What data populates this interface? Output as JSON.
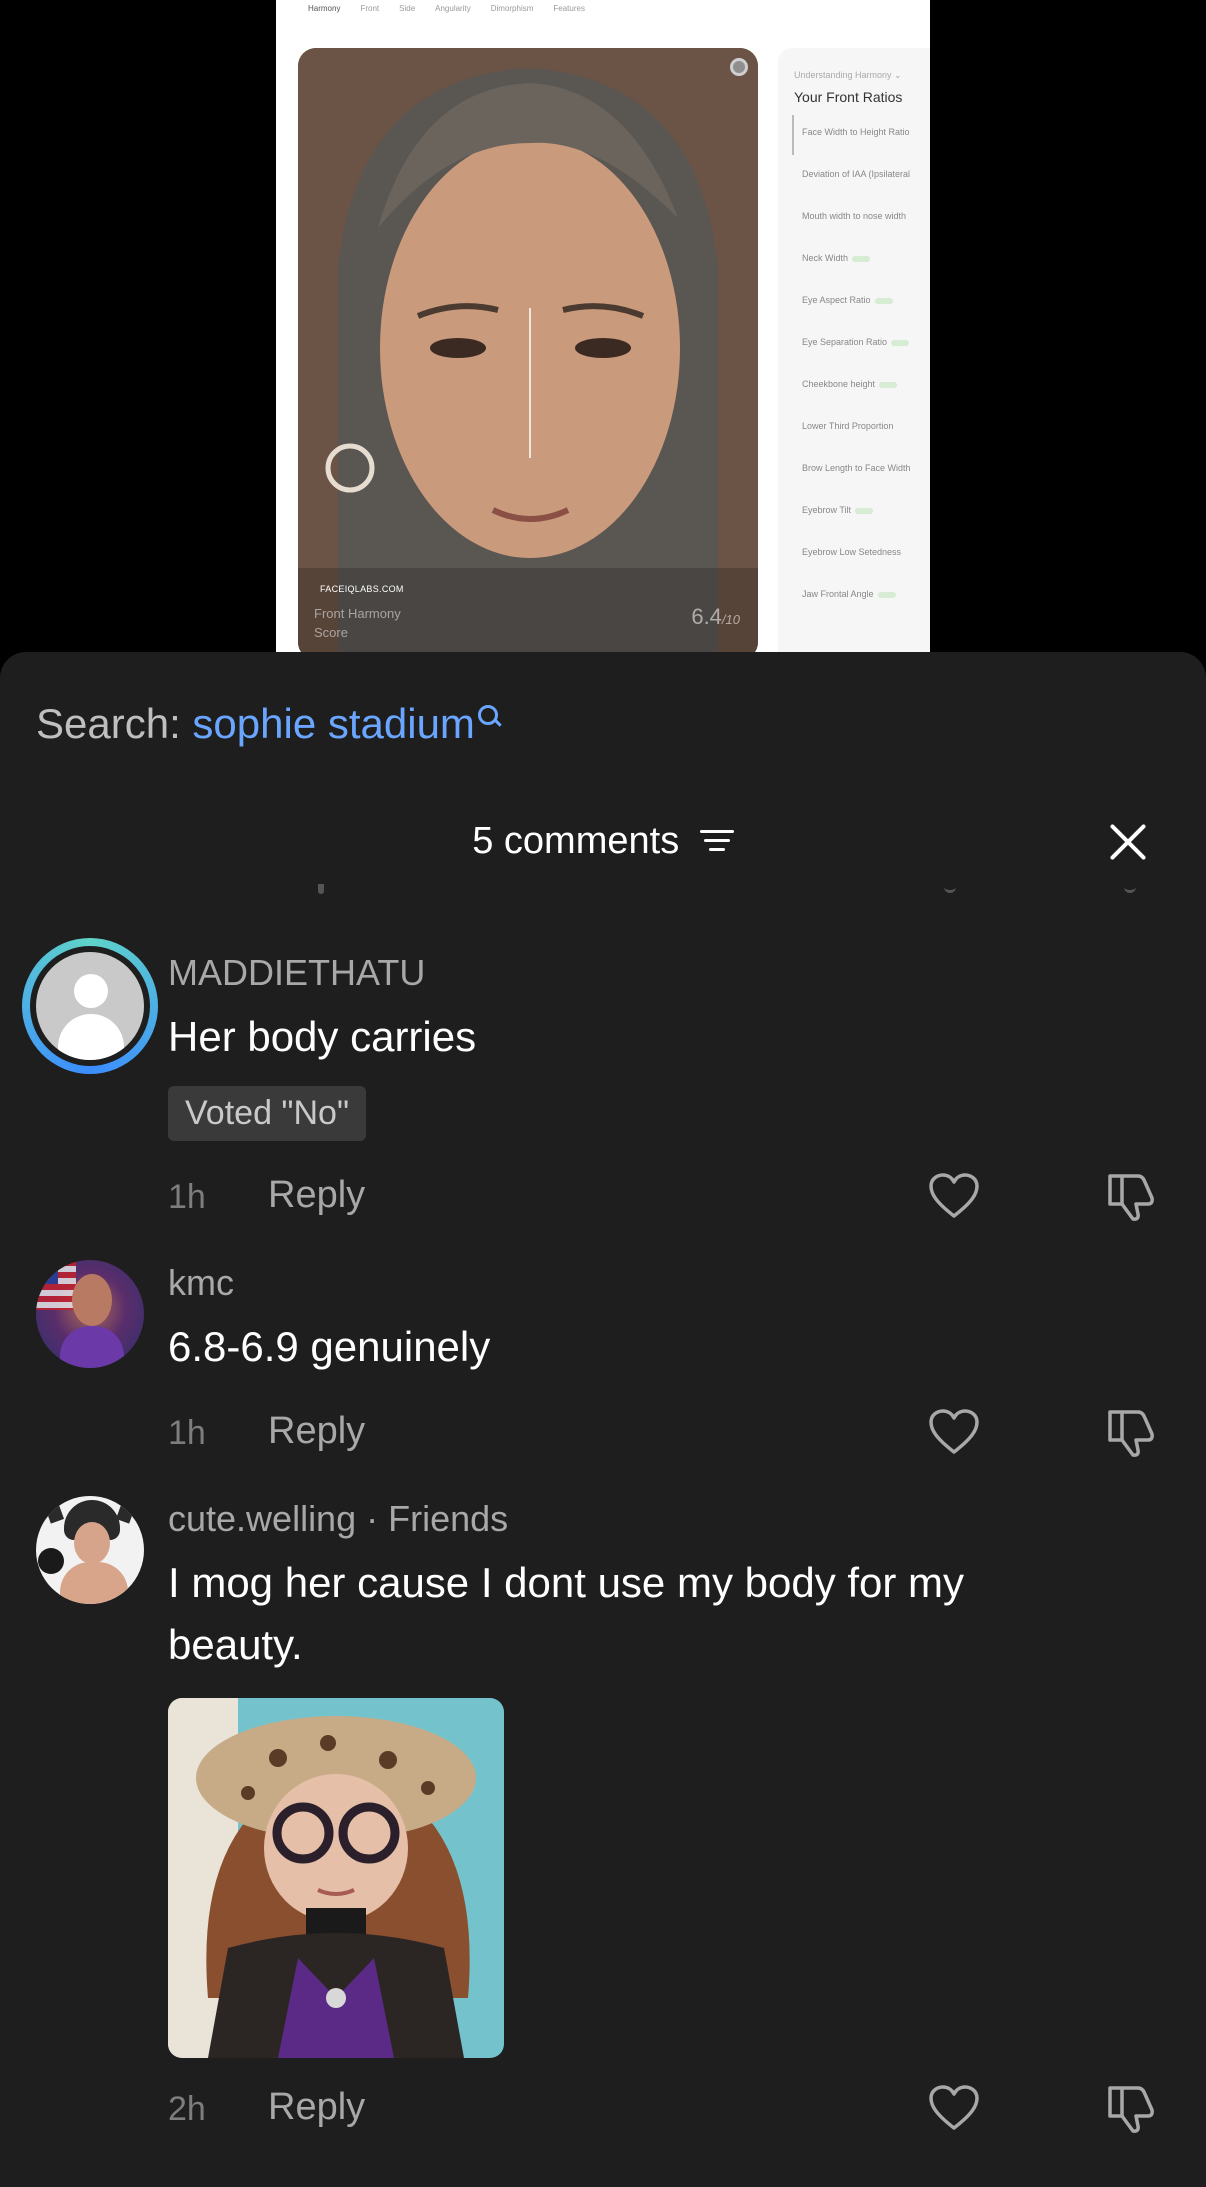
{
  "video": {
    "tabs": [
      "Harmony",
      "Front",
      "Side",
      "Angularity",
      "Dimorphism",
      "Features"
    ],
    "brand": "FACEIQLABS.COM",
    "label_line1": "Front Harmony",
    "label_line2": "Score",
    "score": "6.4",
    "score_suffix": "/10",
    "panel_hint": "Understanding Harmony ⌄",
    "panel_title": "Your Front Ratios",
    "ratios": [
      "Face Width to Height Ratio",
      "Deviation of IAA (Ipsilateral",
      "Mouth width to nose width",
      "Neck Width",
      "Eye Aspect Ratio",
      "Eye Separation Ratio",
      "Cheekbone height",
      "Lower Third Proportion",
      "Brow Length to Face Width",
      "Eyebrow Tilt",
      "Eyebrow Low Setedness",
      "Jaw Frontal Angle"
    ]
  },
  "search": {
    "prefix": "Search:",
    "term": "sophie stadium"
  },
  "header": {
    "count_label": "5 comments"
  },
  "comments": [
    {
      "username": "MADDIETHATU",
      "text": "Her body carries",
      "badge": "Voted \"No\"",
      "time": "1h",
      "reply_label": "Reply"
    },
    {
      "username": "kmc",
      "text": "6.8-6.9 genuinely",
      "time": "1h",
      "reply_label": "Reply"
    },
    {
      "username": "cute.welling · Friends",
      "text": "I mog her cause I dont use my body for my beauty.",
      "time": "2h",
      "reply_label": "Reply"
    }
  ],
  "colors": {
    "accent": "#6aa6ff",
    "sheet_bg": "#1e1e1f",
    "badge_bg": "#3a3a3a"
  },
  "icons": [
    "search-icon",
    "filter-icon",
    "close-icon",
    "heart-icon",
    "dislike-icon",
    "avatar"
  ]
}
